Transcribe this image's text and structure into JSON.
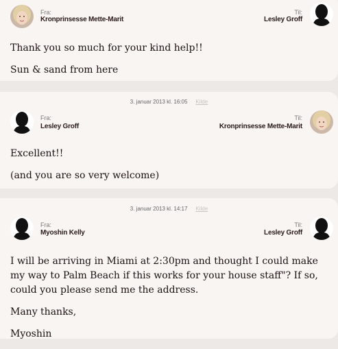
{
  "messages": [
    {
      "from_label": "Fra:",
      "from_name": "Kronprinsesse Mette-Marit",
      "to_label": "Til:",
      "to_name": "Lesley Groff",
      "paragraphs": [
        "Thank you so much for your kind help!!",
        "Sun & sand from here"
      ]
    },
    {
      "date": "3. januar 2013 kl. 16:05",
      "source": "Kilde",
      "from_label": "Fra:",
      "from_name": "Lesley Groff",
      "to_label": "Til:",
      "to_name": "Kronprinsesse Mette-Marit",
      "paragraphs": [
        "Excellent!!",
        "(and you are so very welcome)"
      ]
    },
    {
      "date": "3. januar 2013 kl. 14:17",
      "source": "Kilde",
      "from_label": "Fra:",
      "from_name": "Myoshin Kelly",
      "to_label": "Til:",
      "to_name": "Lesley Groff",
      "paragraphs": [
        "I will be arriving in Miami at 2:30pm and thought I could make my way to Palm Beach if this works for your house staff\"? If so, could you please send me the address.",
        "Many thanks,",
        "Myoshin"
      ]
    }
  ]
}
